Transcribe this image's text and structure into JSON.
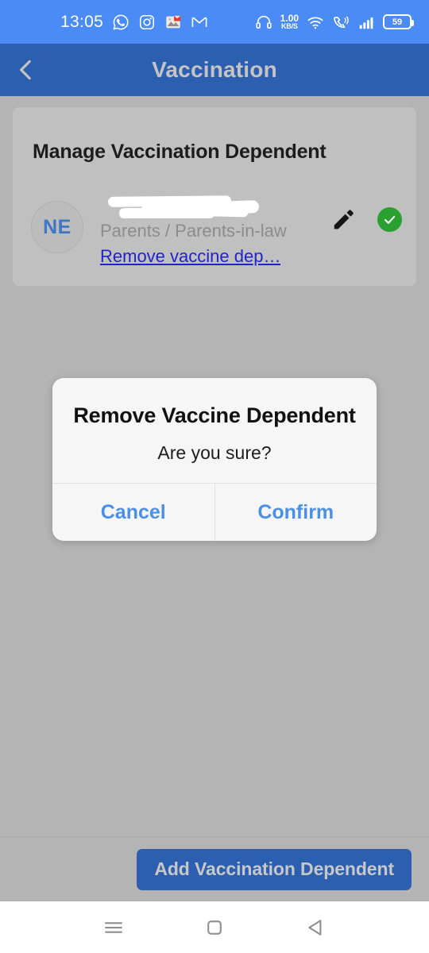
{
  "status_bar": {
    "time": "13:05",
    "left_icons": [
      "whatsapp-icon",
      "instagram-icon",
      "photo-notification-icon",
      "gmail-icon"
    ],
    "right_icons": [
      "headset-icon",
      "wifi-icon",
      "call-vibrate-icon",
      "signal-bars-icon"
    ],
    "network_speed": "1.00",
    "network_unit": "KB/S",
    "battery_level": "59",
    "background_color": "#4a8bf5"
  },
  "app_bar": {
    "title": "Vaccination",
    "back_icon": "chevron-left-icon",
    "background_color": "#2d5fb0",
    "title_color": "#c4c4c4"
  },
  "card": {
    "title": "Manage Vaccination Dependent",
    "dependent": {
      "avatar_initials": "NE",
      "avatar_text_color": "#3f76c4",
      "name": "",
      "name_redacted": true,
      "relationship": "Parents / Parents-in-law",
      "remove_link": "Remove vaccine dep…",
      "remove_link_color": "#2222cc",
      "edit_icon": "pencil-icon",
      "status_icon": "check-circle-icon",
      "status_color": "#2aa031"
    }
  },
  "footer": {
    "add_button_label": "Add Vaccination Dependent",
    "add_button_color": "#2d5fb0"
  },
  "dialog": {
    "title": "Remove Vaccine Dependent",
    "message": "Are you sure?",
    "cancel_label": "Cancel",
    "confirm_label": "Confirm",
    "button_color": "#4a90e8",
    "background_color": "#f6f6f6"
  },
  "nav_bar": {
    "recents_icon": "menu-lines-icon",
    "home_icon": "square-home-icon",
    "back_icon": "triangle-back-icon"
  }
}
